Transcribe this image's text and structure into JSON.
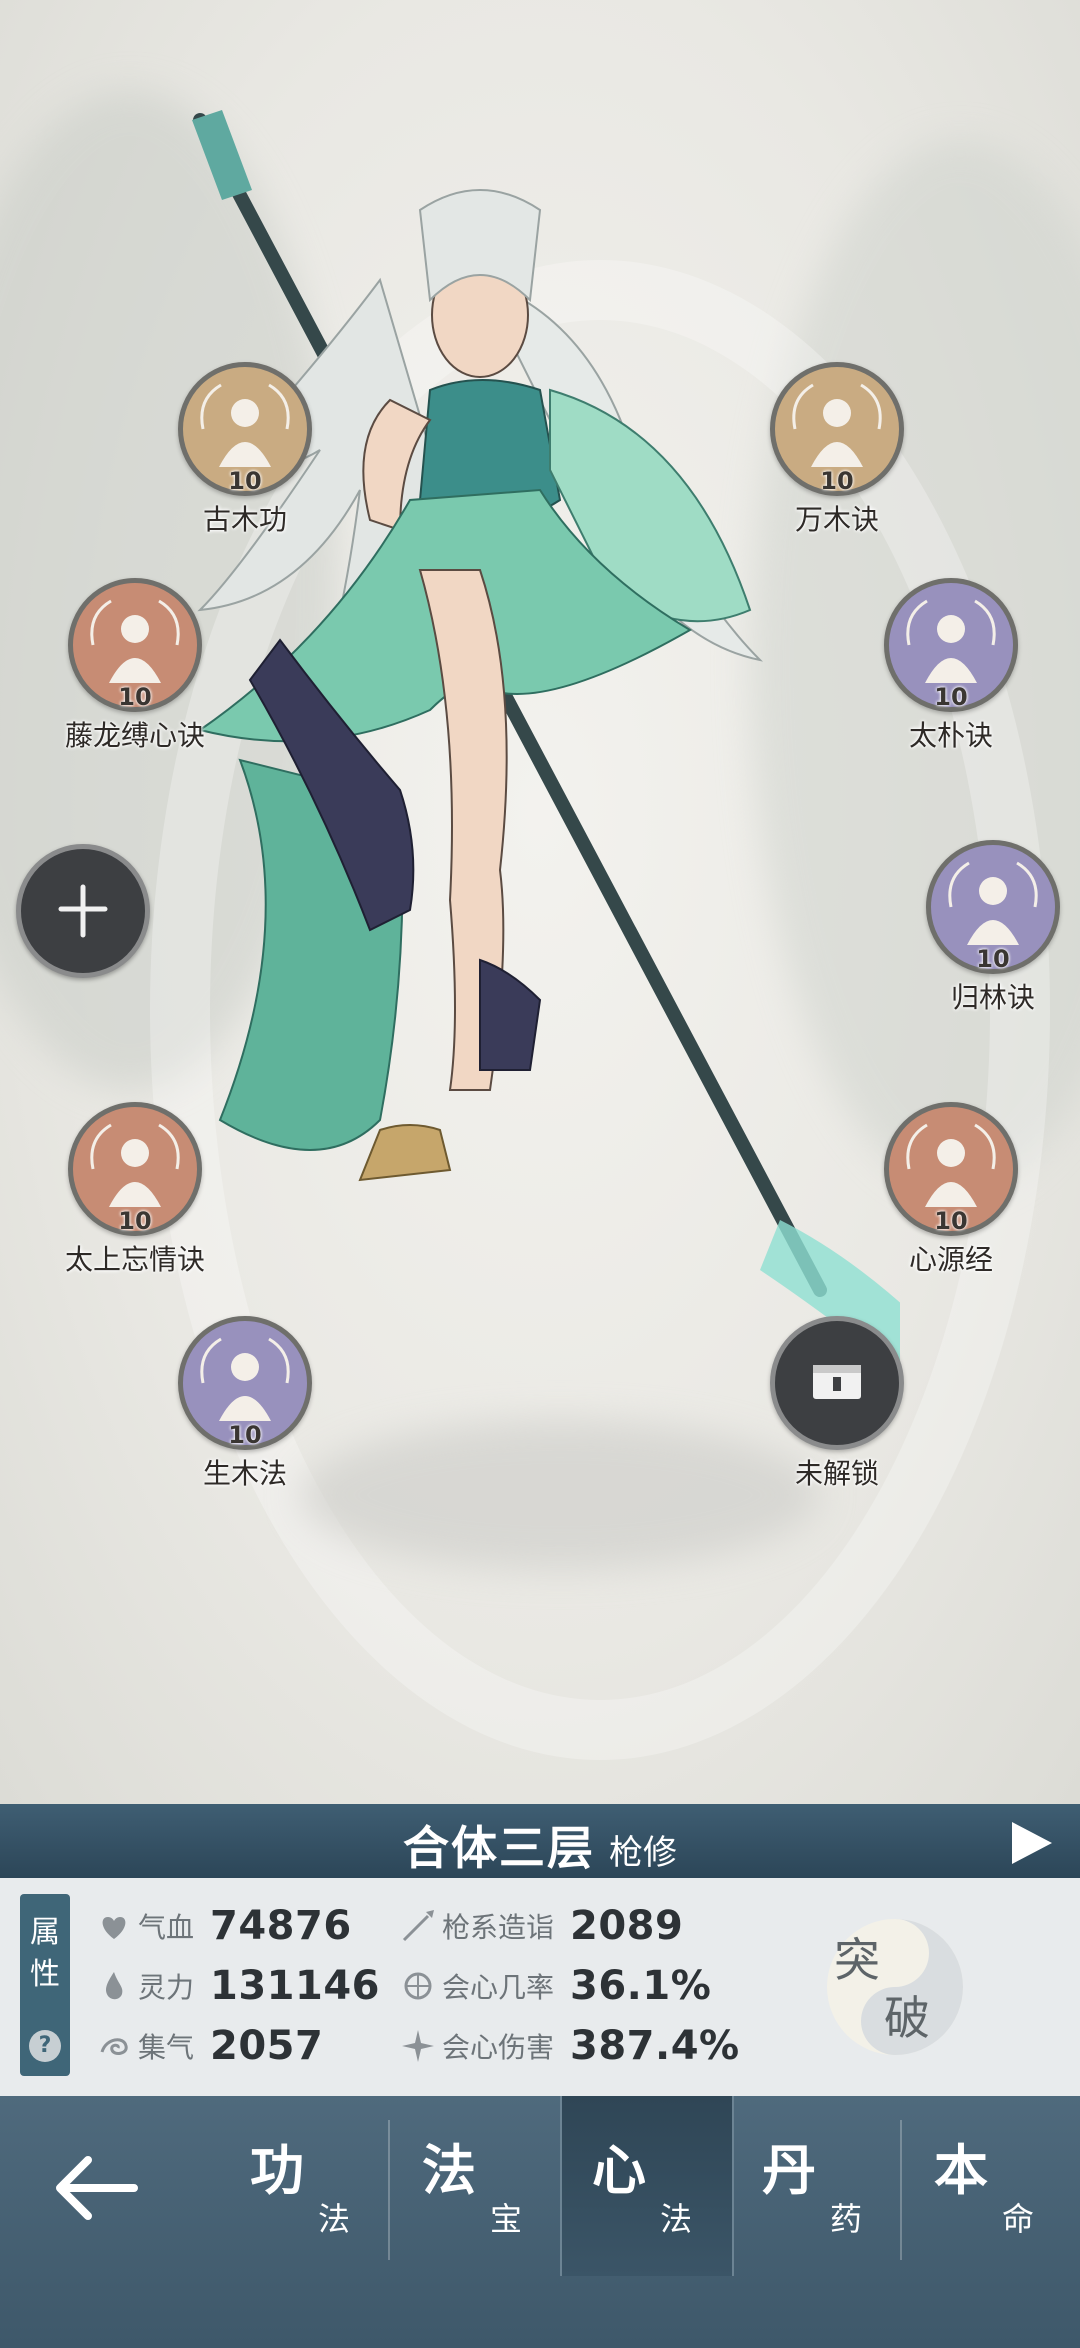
{
  "skills": [
    {
      "name": "古木功",
      "level": "10"
    },
    {
      "name": "万木诀",
      "level": "10"
    },
    {
      "name": "藤龙缚心诀",
      "level": "10"
    },
    {
      "name": "太朴诀",
      "level": "10"
    },
    {
      "name": "归林诀",
      "level": "10"
    },
    {
      "name": "太上忘情诀",
      "level": "10"
    },
    {
      "name": "心源经",
      "level": "10"
    },
    {
      "name": "生木法",
      "level": "10"
    }
  ],
  "locked_slot": {
    "label": "未解锁"
  },
  "realm": {
    "title": "合体三层",
    "class": "枪修"
  },
  "attributes": {
    "tag_top": "属",
    "tag_bottom": "性",
    "help": "?",
    "stats": [
      {
        "label": "气血",
        "value": "74876"
      },
      {
        "label": "枪系造诣",
        "value": "2089"
      },
      {
        "label": "灵力",
        "value": "131146"
      },
      {
        "label": "会心几率",
        "value": "36.1%"
      },
      {
        "label": "集气",
        "value": "2057"
      },
      {
        "label": "会心伤害",
        "value": "387.4%"
      }
    ]
  },
  "breakthrough": {
    "char1": "突",
    "char2": "破"
  },
  "nav": {
    "tabs": [
      {
        "main": "功",
        "sub": "法"
      },
      {
        "main": "法",
        "sub": "宝"
      },
      {
        "main": "心",
        "sub": "法"
      },
      {
        "main": "丹",
        "sub": "药"
      },
      {
        "main": "本",
        "sub": "命"
      }
    ]
  },
  "colors": {
    "nav_bg": "#4f6a7d",
    "realm_bar": "#3f5e73",
    "skill_gold": "#c9ab82",
    "skill_copper": "#c78c74",
    "skill_violet": "#9891bd"
  }
}
